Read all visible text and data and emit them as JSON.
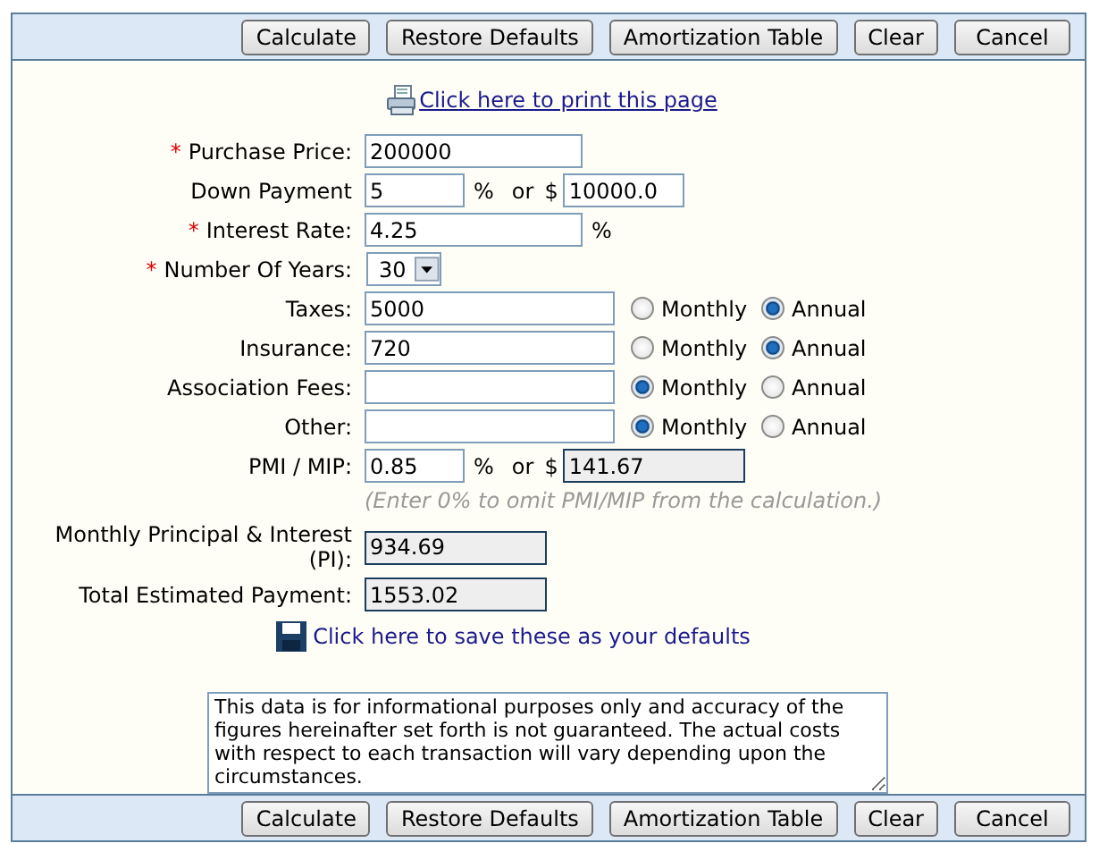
{
  "top_toolbar": {
    "buttons": [
      "Calculate",
      "Restore Defaults",
      "Amortization Table",
      "Clear",
      "Cancel"
    ]
  },
  "print_link": "Click here to print this page",
  "rows": [
    {
      "kind": "input",
      "marker": "*",
      "label": "Purchase Price:",
      "value": "200000"
    },
    {
      "kind": "split",
      "label": "Down Payment",
      "percent": "5",
      "pct_sign": "%",
      "or": "or",
      "dollar": "$",
      "amount": "10000.0",
      "readonly": false
    },
    {
      "kind": "input",
      "marker": "*",
      "label": "Interest Rate:",
      "value": "4.25",
      "suffix": "%"
    },
    {
      "kind": "select",
      "marker": "*",
      "label": "Number Of Years:",
      "value": "30"
    },
    {
      "kind": "period",
      "label": "Taxes:",
      "value": "5000",
      "options": [
        {
          "label": "Monthly",
          "selected": false
        },
        {
          "label": "Annual",
          "selected": true
        }
      ]
    },
    {
      "kind": "period",
      "label": "Insurance:",
      "value": "720",
      "options": [
        {
          "label": "Monthly",
          "selected": false
        },
        {
          "label": "Annual",
          "selected": true
        }
      ]
    },
    {
      "kind": "period",
      "label": "Association Fees:",
      "value": "",
      "options": [
        {
          "label": "Monthly",
          "selected": true
        },
        {
          "label": "Annual",
          "selected": false
        }
      ]
    },
    {
      "kind": "period",
      "label": "Other:",
      "value": "",
      "options": [
        {
          "label": "Monthly",
          "selected": true
        },
        {
          "label": "Annual",
          "selected": false
        }
      ]
    },
    {
      "kind": "split",
      "label": "PMI / MIP:",
      "percent": "0.85",
      "pct_sign": "%",
      "or": "or",
      "dollar": "$",
      "amount": "141.67",
      "readonly": true
    },
    {
      "kind": "hint",
      "text": "(Enter 0% to omit PMI/MIP from the calculation.)"
    },
    {
      "kind": "output",
      "label": "Monthly Principal & Interest (PI):",
      "value": "934.69"
    },
    {
      "kind": "output",
      "label": "Total Estimated Payment:",
      "value": "1553.02"
    }
  ],
  "save_link": "Click here to save these as your defaults",
  "disclaimer": "This data is for informational purposes only and accuracy of the figures hereinafter set forth is not guaranteed. The actual costs with respect to each transaction will vary depending upon the circumstances.",
  "bottom_toolbar": {
    "buttons": [
      "Calculate",
      "Restore Defaults",
      "Amortization Table",
      "Clear",
      "Cancel"
    ]
  }
}
